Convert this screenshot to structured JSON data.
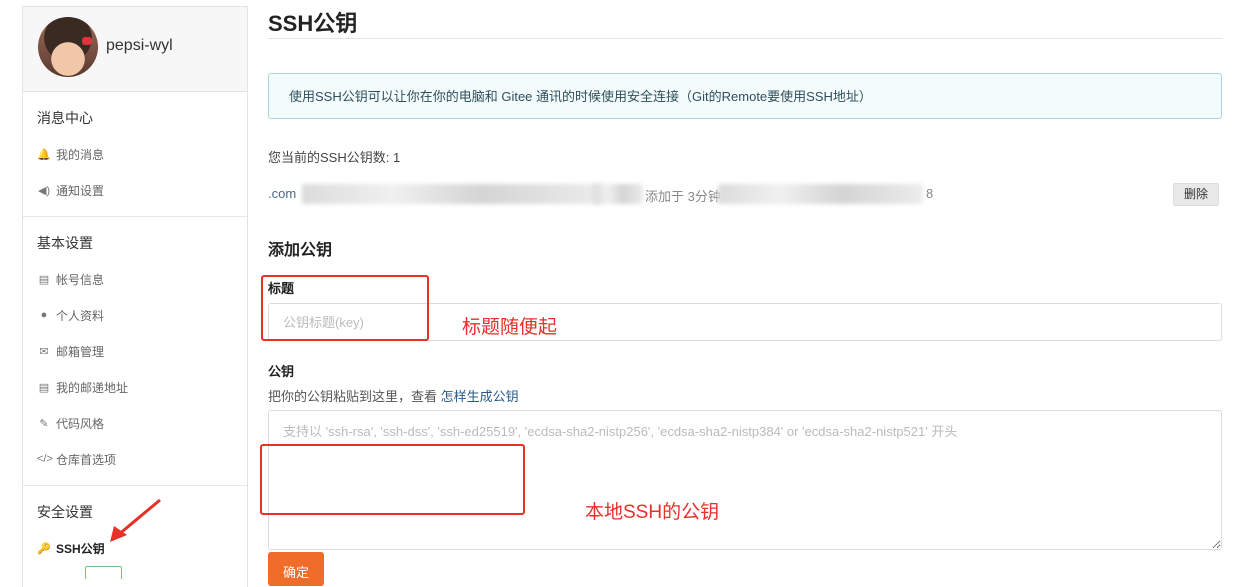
{
  "sidebar": {
    "username": "pepsi-wyl",
    "groups": [
      {
        "title": "消息中心",
        "items": [
          {
            "label": "我的消息",
            "icon": "bell-icon",
            "glyph": "🔔"
          },
          {
            "label": "通知设置",
            "icon": "speaker-icon",
            "glyph": "◀)"
          }
        ]
      },
      {
        "title": "基本设置",
        "items": [
          {
            "label": "帐号信息",
            "icon": "id-card-icon",
            "glyph": "▤"
          },
          {
            "label": "个人资料",
            "icon": "user-icon",
            "glyph": "●"
          },
          {
            "label": "邮箱管理",
            "icon": "envelope-icon",
            "glyph": "✉"
          },
          {
            "label": "我的邮递地址",
            "icon": "address-card-icon",
            "glyph": "▤"
          },
          {
            "label": "代码风格",
            "icon": "brush-icon",
            "glyph": "✎"
          },
          {
            "label": "仓库首选项",
            "icon": "code-icon",
            "glyph": "</>"
          }
        ]
      },
      {
        "title": "安全设置",
        "items": [
          {
            "label": "SSH公钥",
            "icon": "key-icon",
            "glyph": "🔑",
            "active": true
          }
        ]
      }
    ]
  },
  "main": {
    "title": "SSH公钥",
    "info": "使用SSH公钥可以让你在你的电脑和 Gitee 通讯的时候使用安全连接（Git的Remote要使用SSH地址）",
    "count_text": "您当前的SSH公钥数: 1",
    "key_entry": {
      "prefix": ".com",
      "added": "添加于 3分钟",
      "tail": "8",
      "delete_label": "删除"
    },
    "add_section_title": "添加公钥",
    "title_field": {
      "label": "标题",
      "placeholder": "公钥标题(key)"
    },
    "key_field": {
      "label": "公钥",
      "hint": "把你的公钥粘贴到这里，查看 ",
      "hint_link": "怎样生成公钥",
      "placeholder": "支持以 'ssh-rsa', 'ssh-dss', 'ssh-ed25519', 'ecdsa-sha2-nistp256', 'ecdsa-sha2-nistp384' or 'ecdsa-sha2-nistp521' 开头"
    },
    "submit_label": "确定"
  },
  "annotations": {
    "title_note": "标题随便起",
    "key_note": "本地SSH的公钥",
    "color": "#e63028"
  },
  "colors": {
    "accent": "#f06c2b",
    "info_border": "#a9d5de",
    "info_bg": "#f4fbfc"
  }
}
